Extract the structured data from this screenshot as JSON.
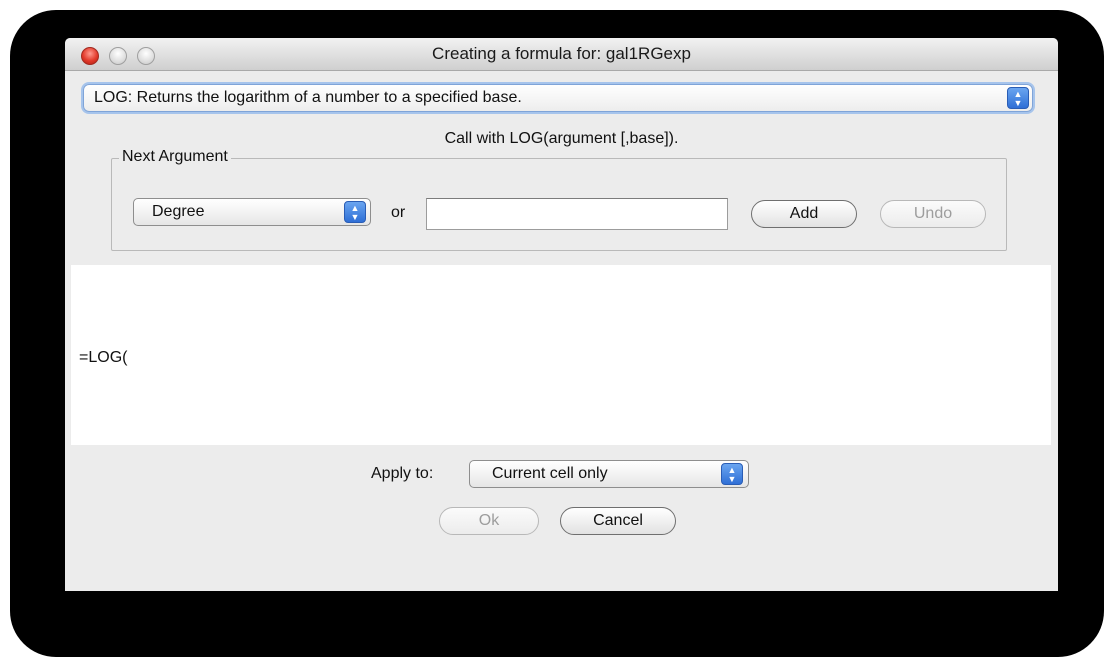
{
  "window": {
    "title": "Creating a formula for: gal1RGexp"
  },
  "function_select": {
    "selected": "LOG: Returns the logarithm of a number to a specified base."
  },
  "call_hint": "Call with LOG(argument [,base]).",
  "next_argument": {
    "group_label": "Next Argument",
    "column_select": "Degree",
    "or_label": "or",
    "value_input": "",
    "add_label": "Add",
    "undo_label": "Undo"
  },
  "formula_text": "=LOG(",
  "apply": {
    "label": "Apply to:",
    "selected": "Current cell only"
  },
  "buttons": {
    "ok": "Ok",
    "cancel": "Cancel"
  },
  "icons": {
    "close": "close-icon",
    "minimize": "minimize-icon",
    "zoom": "zoom-icon",
    "stepper": "up-down-arrows-icon"
  },
  "colors": {
    "focus_ring": "#a6c4ec",
    "stepper_blue": "#2f6fd6",
    "close_red": "#e23a2b"
  }
}
